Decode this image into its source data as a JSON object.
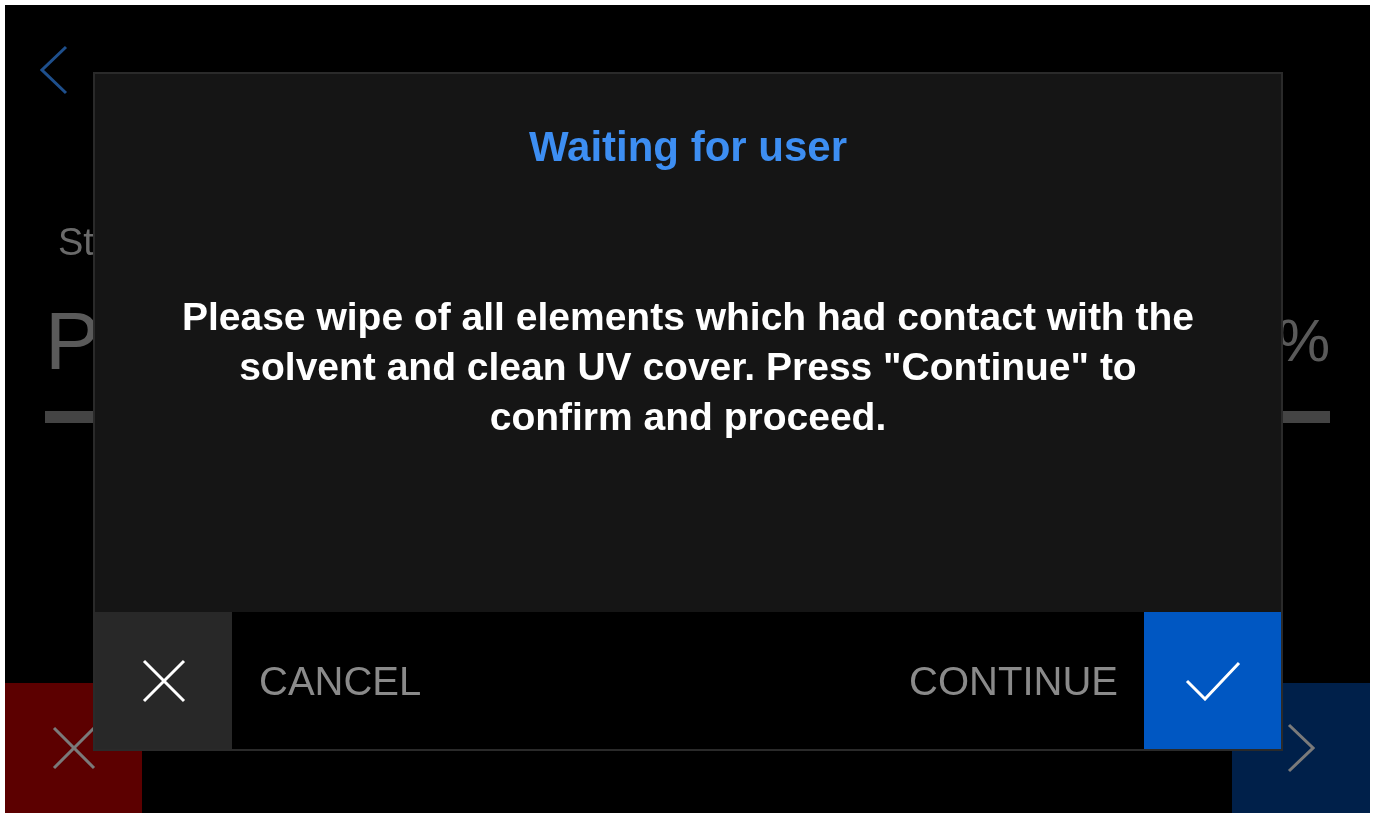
{
  "background": {
    "step_label": "St",
    "big_value": "P",
    "percent": "%",
    "buttons": [
      {
        "kind": "cancel"
      },
      {
        "kind": "skip"
      }
    ]
  },
  "dialog": {
    "title": "Waiting for user",
    "message": "Please wipe of all elements which had contact with the solvent and clean UV cover. Press \"Continue\" to confirm and proceed.",
    "buttons": [
      {
        "kind": "cancel",
        "label": "CANCEL"
      },
      {
        "kind": "continue",
        "label": "CONTINUE"
      }
    ]
  }
}
